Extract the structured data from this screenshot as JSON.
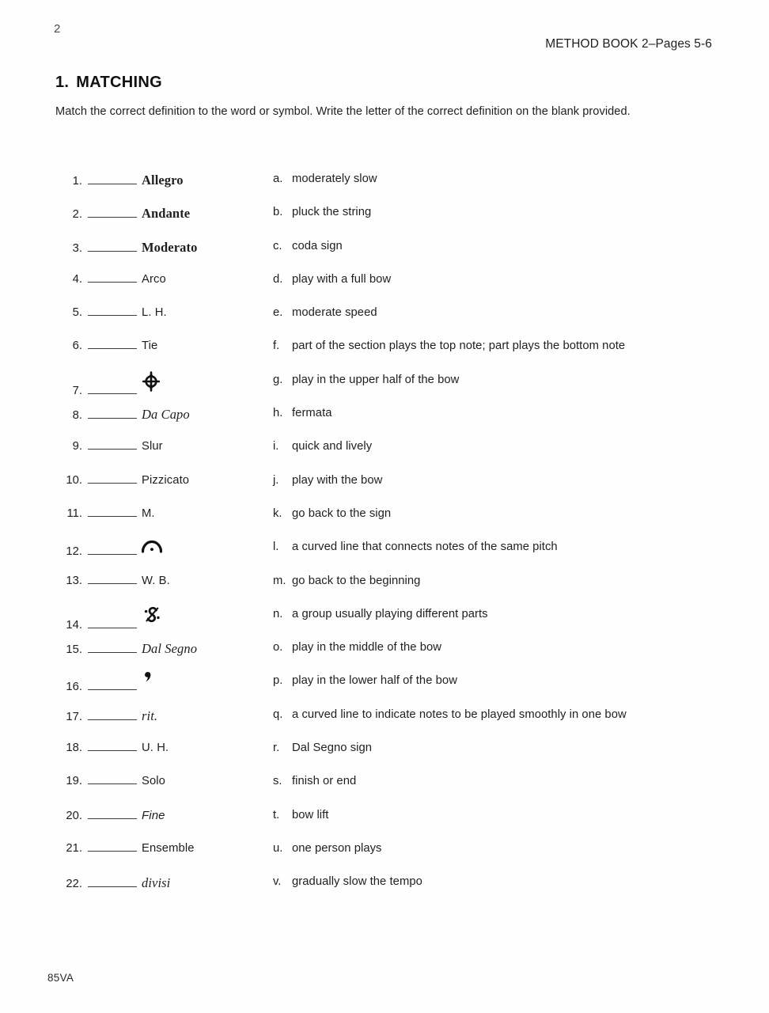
{
  "header": {
    "page_number": "2",
    "book_reference": "METHOD BOOK 2–Pages 5-6"
  },
  "section": {
    "number": "1.",
    "title": "MATCHING",
    "instructions": "Match the correct definition to the word or symbol. Write the letter of the correct definition on the blank provided."
  },
  "footer": {
    "code": "85VA"
  },
  "matching": {
    "terms": [
      {
        "number": "1.",
        "text": "Allegro",
        "style": "bold-serif",
        "answer": ""
      },
      {
        "number": "2.",
        "text": "Andante",
        "style": "bold-serif",
        "answer": ""
      },
      {
        "number": "3.",
        "text": "Moderato",
        "style": "bold-serif",
        "answer": ""
      },
      {
        "number": "4.",
        "text": "Arco",
        "style": "plain",
        "answer": ""
      },
      {
        "number": "5.",
        "text": "L. H.",
        "style": "plain",
        "answer": ""
      },
      {
        "number": "6.",
        "text": "Tie",
        "style": "plain",
        "answer": ""
      },
      {
        "number": "7.",
        "text": "",
        "style": "glyph",
        "glyph": "coda-symbol",
        "answer": ""
      },
      {
        "number": "8.",
        "text": "Da Capo",
        "style": "italic-serif",
        "answer": ""
      },
      {
        "number": "9.",
        "text": "Slur",
        "style": "plain",
        "answer": ""
      },
      {
        "number": "10.",
        "text": "Pizzicato",
        "style": "plain",
        "answer": ""
      },
      {
        "number": "11.",
        "text": "M.",
        "style": "plain",
        "answer": ""
      },
      {
        "number": "12.",
        "text": "",
        "style": "glyph",
        "glyph": "fermata-symbol",
        "answer": ""
      },
      {
        "number": "13.",
        "text": "W. B.",
        "style": "plain",
        "answer": ""
      },
      {
        "number": "14.",
        "text": "",
        "style": "glyph",
        "glyph": "segno-symbol",
        "answer": ""
      },
      {
        "number": "15.",
        "text": "Dal Segno",
        "style": "italic-serif",
        "answer": ""
      },
      {
        "number": "16.",
        "text": "",
        "style": "glyph",
        "glyph": "breath-mark-symbol",
        "answer": ""
      },
      {
        "number": "17.",
        "text": "rit.",
        "style": "italic-serif",
        "answer": ""
      },
      {
        "number": "18.",
        "text": "U. H.",
        "style": "plain",
        "answer": ""
      },
      {
        "number": "19.",
        "text": "Solo",
        "style": "plain",
        "answer": ""
      },
      {
        "number": "20.",
        "text": "Fine",
        "style": "italic-sans",
        "answer": ""
      },
      {
        "number": "21.",
        "text": "Ensemble",
        "style": "plain",
        "answer": ""
      },
      {
        "number": "22.",
        "text": "divisi",
        "style": "italic-serif",
        "answer": ""
      }
    ],
    "definitions": [
      {
        "letter": "a.",
        "text": "moderately slow"
      },
      {
        "letter": "b.",
        "text": "pluck the string"
      },
      {
        "letter": "c.",
        "text": "coda sign"
      },
      {
        "letter": "d.",
        "text": "play with a full bow"
      },
      {
        "letter": "e.",
        "text": "moderate speed"
      },
      {
        "letter": "f.",
        "text": "part of the section plays the top note; part plays the bottom note"
      },
      {
        "letter": "g.",
        "text": "play in the upper half of the bow"
      },
      {
        "letter": "h.",
        "text": "fermata"
      },
      {
        "letter": "i.",
        "text": "quick and lively"
      },
      {
        "letter": "j.",
        "text": "play with the bow"
      },
      {
        "letter": "k.",
        "text": "go back to the sign"
      },
      {
        "letter": "l.",
        "text": "a curved line that connects notes of the same pitch"
      },
      {
        "letter": "m.",
        "text": "go back to the beginning"
      },
      {
        "letter": "n.",
        "text": "a group usually playing different parts"
      },
      {
        "letter": "o.",
        "text": "play in the middle of the bow"
      },
      {
        "letter": "p.",
        "text": "play in the lower half of the bow"
      },
      {
        "letter": "q.",
        "text": "a curved line to indicate notes to be played smoothly in one bow"
      },
      {
        "letter": "r.",
        "text": "Dal Segno sign"
      },
      {
        "letter": "s.",
        "text": "finish or end"
      },
      {
        "letter": "t.",
        "text": "bow lift"
      },
      {
        "letter": "u.",
        "text": "one person plays"
      },
      {
        "letter": "v.",
        "text": "gradually slow the tempo"
      }
    ]
  }
}
